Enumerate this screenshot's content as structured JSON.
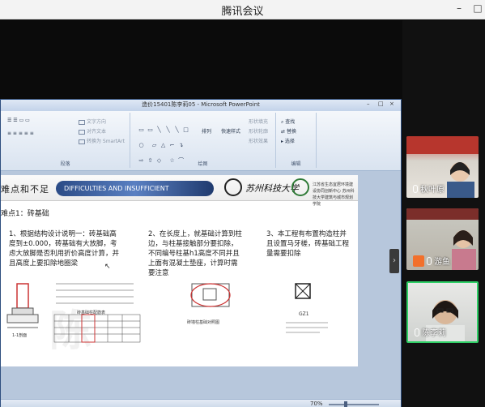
{
  "app": {
    "title": "腾讯会议"
  },
  "ppt": {
    "window_title": "造价15401陈李莉05 - Microsoft PowerPoint",
    "ribbon": {
      "group_labels": [
        "段落",
        "绘图",
        "编辑"
      ],
      "text_items": [
        "文字方向",
        "对齐文本",
        "转换为 SmartArt",
        "排列",
        "快速样式",
        "形状填充",
        "形状轮廓",
        "形状效果",
        "查找",
        "替换",
        "选择"
      ]
    },
    "status": {
      "zoom": "70%"
    }
  },
  "slide": {
    "header_text": "难点和不足",
    "header_pill": "DIFFICULTIES AND INSUFFICIENT",
    "university": "苏州科技大学",
    "school": "江苏省生态宜居环境建设协同创新中心 苏州科技大学建筑与城市规划学院",
    "subtitle": "难点1：砖基础",
    "col1": "1、根据结构设计说明一：砖基础高度到±0.000，砖基础有大放脚，考虑大放脚是否利用折价高度计算，并且高度上要扣除地圈梁",
    "col2": "2、在长度上，就基础计算到柱边，与柱基接触部分要扣除，不同编号柱基h1高度不同并且上面有混凝土垫座，计算时需要注意",
    "col3": "3、本工程有布置构造柱并且设置马牙槎，砖基础工程量需要扣除",
    "fig_labels": [
      "砖基础柱配筋表",
      "1-1剖面",
      "砖墙柱基础对照图",
      "GZ1"
    ]
  },
  "participants": [
    {
      "name": "秋叶原"
    },
    {
      "name": "游鱼"
    },
    {
      "name": "陈李莉"
    }
  ]
}
